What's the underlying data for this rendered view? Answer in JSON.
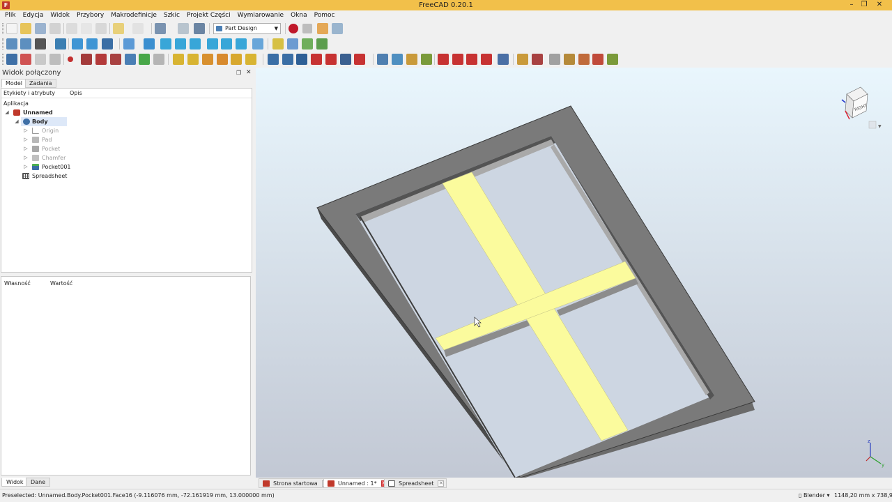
{
  "window": {
    "title": "FreeCAD 0.20.1",
    "minimize": "–",
    "maximize": "❐",
    "close": "✕"
  },
  "menu": [
    "Plik",
    "Edycja",
    "Widok",
    "Przybory",
    "Makrodefinicje",
    "Szkic",
    "Projekt Części",
    "Wymiarowanie",
    "Okna",
    "Pomoc"
  ],
  "toolbar": {
    "workbench": "Part Design"
  },
  "combo": {
    "title": "Widok połączony",
    "tabs": {
      "model": "Model",
      "tasks": "Zadania"
    },
    "tree_header": {
      "labels": "Etykiety i atrybuty",
      "description": "Opis"
    },
    "tree": [
      {
        "label": "Aplikacja"
      },
      {
        "label": "Unnamed"
      },
      {
        "label": "Body"
      },
      {
        "label": "Origin"
      },
      {
        "label": "Pad"
      },
      {
        "label": "Pocket"
      },
      {
        "label": "Chamfer"
      },
      {
        "label": "Pocket001"
      },
      {
        "label": "Spreadsheet"
      }
    ],
    "props_header": {
      "property": "Własność",
      "value": "Wartość"
    },
    "bottom_tabs": {
      "view": "Widok",
      "data": "Dane"
    }
  },
  "viewport": {
    "navcube_label": "RIGHT",
    "colors": {
      "frame_top": "#7a7a7a",
      "frame_side": "#545454",
      "rail": "#a9a9a9",
      "cross": "#fbfb9d"
    }
  },
  "view_tabs": [
    {
      "label": "Strona startowa"
    },
    {
      "label": "Unnamed : 1*"
    },
    {
      "label": "Spreadsheet"
    }
  ],
  "status": {
    "preselection": "Preselected: Unnamed.Body.Pocket001.Face16 (-9.116076 mm, -72.161919 mm, 13.000000 mm)",
    "navigation": "Blender",
    "dimensions": "1148,20 mm x 738,91 mm"
  }
}
